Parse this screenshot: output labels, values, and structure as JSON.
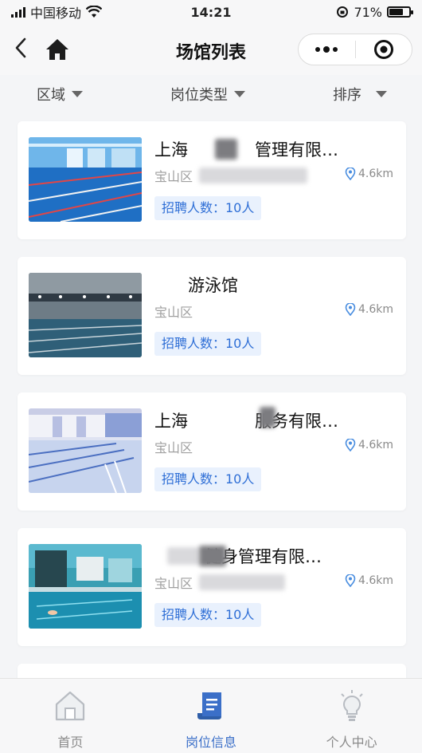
{
  "status_bar": {
    "carrier": "中国移动",
    "time": "14:21",
    "battery": "71%",
    "battery_level": 0.71
  },
  "nav": {
    "title": "场馆列表"
  },
  "filters": [
    {
      "label": "区域"
    },
    {
      "label": "岗位类型"
    },
    {
      "label": "排序"
    }
  ],
  "venues": [
    {
      "name": "上海　　　　管理有限…",
      "district": "宝山区",
      "distance": "4.6km",
      "hiring": "招聘人数：10人",
      "image_icon": "pool-photo-1"
    },
    {
      "name": "　　游泳馆",
      "district": "宝山区",
      "distance": "4.6km",
      "hiring": "招聘人数：10人",
      "image_icon": "pool-photo-2"
    },
    {
      "name": "上海　　　　服务有限…",
      "district": "宝山区",
      "distance": "4.6km",
      "hiring": "招聘人数：10人",
      "image_icon": "pool-photo-3"
    },
    {
      "name": "　　　健身管理有限…",
      "district": "宝山区",
      "distance": "4.6km",
      "hiring": "招聘人数：10人",
      "image_icon": "pool-photo-4"
    }
  ],
  "tabs": [
    {
      "label": "首页",
      "icon": "home-icon",
      "active": false
    },
    {
      "label": "岗位信息",
      "icon": "document-icon",
      "active": true
    },
    {
      "label": "个人中心",
      "icon": "lightbulb-icon",
      "active": false
    }
  ],
  "colors": {
    "accent": "#3b6fc8",
    "tag_bg": "#e9f1fd",
    "tag_text": "#2f6fd6",
    "page_bg": "#f4f5f7"
  }
}
